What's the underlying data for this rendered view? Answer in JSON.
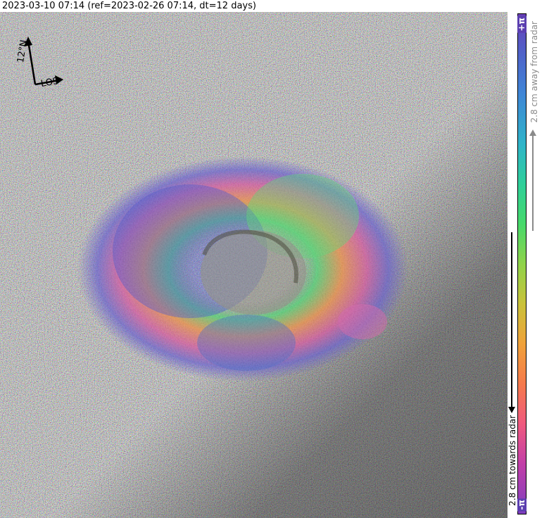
{
  "title": "2023-03-10 07:14 (ref=2023-02-26 07:14, dt=12 days)",
  "compass": {
    "north_label": "12°N",
    "los_label": "LOS"
  },
  "colorbar": {
    "top_label": "+π",
    "bottom_label": "-π",
    "away_label": "2.8 cm away from radar",
    "towards_label": "2.8 cm towards radar"
  }
}
